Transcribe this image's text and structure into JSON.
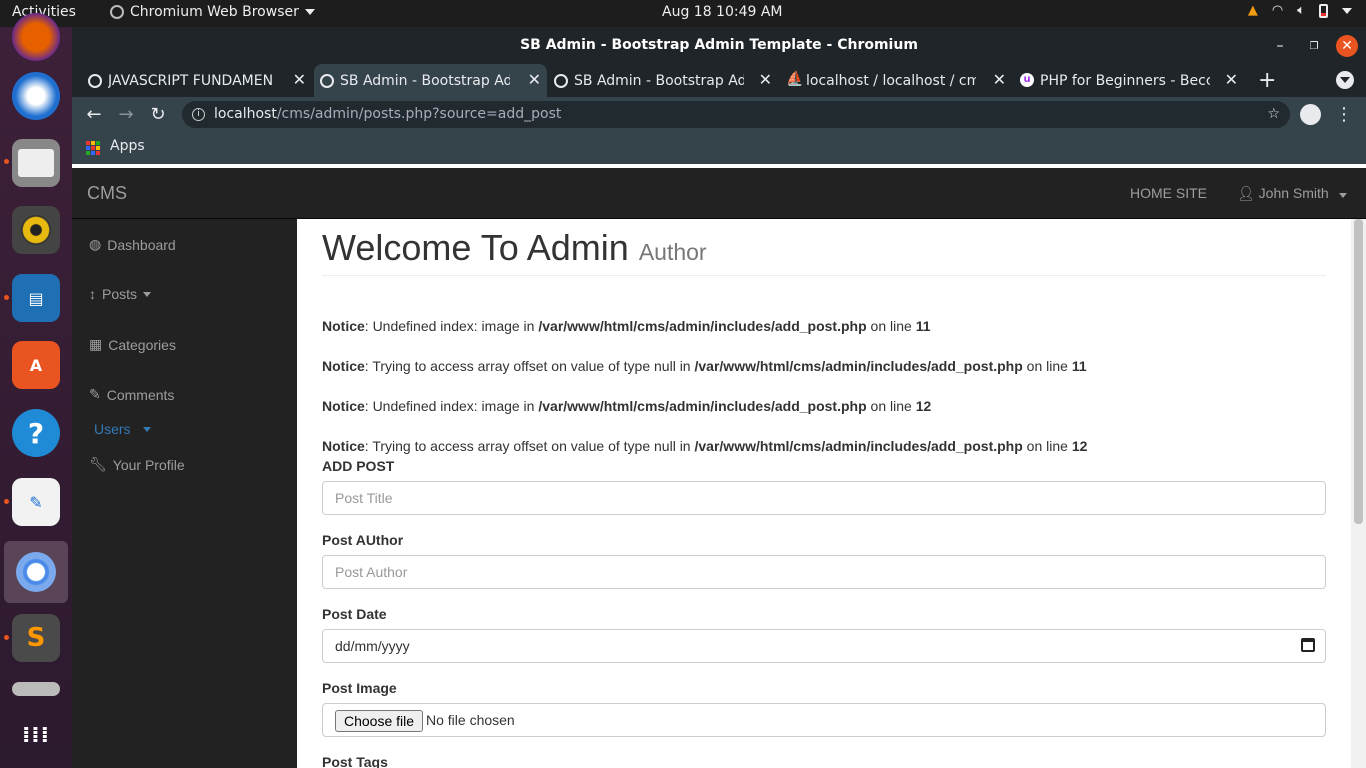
{
  "topbar": {
    "activities": "Activities",
    "app_name": "Chromium Web Browser",
    "clock": "Aug 18  10:49 AM"
  },
  "window": {
    "title": "SB Admin - Bootstrap Admin Template - Chromium"
  },
  "tabs": [
    {
      "label": "JAVASCRIPT FUNDAMEN",
      "active": false
    },
    {
      "label": "SB Admin - Bootstrap Ad",
      "active": true
    },
    {
      "label": "SB Admin - Bootstrap Ad",
      "active": false
    },
    {
      "label": "localhost / localhost / cm",
      "active": false
    },
    {
      "label": "PHP for Beginners - Becc",
      "active": false
    }
  ],
  "omnibox": {
    "host": "localhost",
    "path": "/cms/admin/posts.php?source=add_post"
  },
  "bookmarks": {
    "apps": "Apps"
  },
  "cms": {
    "brand": "CMS",
    "home_site": "HOME SITE",
    "user": "John Smith"
  },
  "sidebar": {
    "items": [
      {
        "label": "Dashboard"
      },
      {
        "label": "Posts"
      },
      {
        "label": "Categories"
      },
      {
        "label": "Comments"
      },
      {
        "label": "Users"
      },
      {
        "label": "Your Profile"
      }
    ]
  },
  "content": {
    "heading": "Welcome To Admin",
    "heading_small": "Author",
    "notices": [
      {
        "label": "Notice",
        "msg": ": Undefined index: image in ",
        "file": "/var/www/html/cms/admin/includes/add_post.php",
        "online": " on line ",
        "line": "11"
      },
      {
        "label": "Notice",
        "msg": ": Trying to access array offset on value of type null in ",
        "file": "/var/www/html/cms/admin/includes/add_post.php",
        "online": " on line ",
        "line": "11"
      },
      {
        "label": "Notice",
        "msg": ": Undefined index: image in ",
        "file": "/var/www/html/cms/admin/includes/add_post.php",
        "online": " on line ",
        "line": "12"
      },
      {
        "label": "Notice",
        "msg": ": Trying to access array offset on value of type null in ",
        "file": "/var/www/html/cms/admin/includes/add_post.php",
        "online": " on line ",
        "line": "12"
      }
    ],
    "add_post": "ADD POST",
    "post_title_placeholder": "Post Title",
    "post_author_label": "Post AUthor",
    "post_author_placeholder": "Post Author",
    "post_date_label": "Post Date",
    "post_date_value": "dd/mm/yyyy",
    "post_image_label": "Post Image",
    "choose_file": "Choose file",
    "no_file": "No file chosen",
    "post_tags_label": "Post Tags"
  }
}
